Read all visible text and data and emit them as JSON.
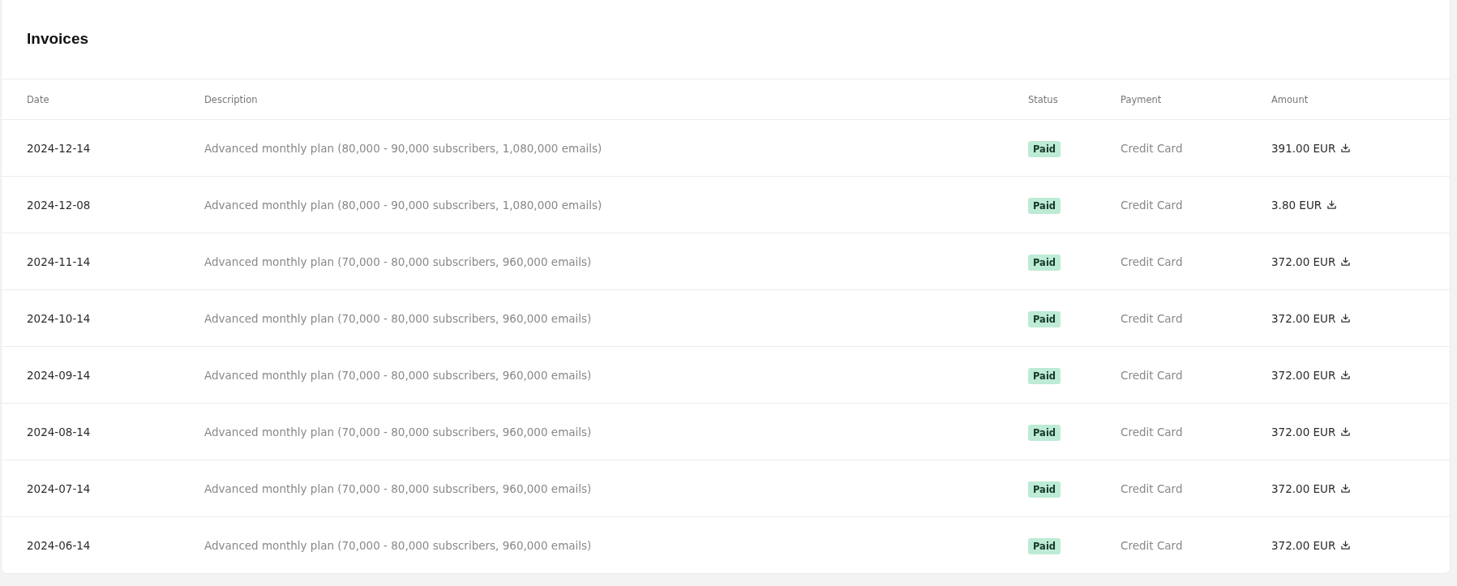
{
  "title": "Invoices",
  "columns": [
    "Date",
    "Description",
    "Status",
    "Payment",
    "Amount"
  ],
  "rows": [
    {
      "date": "2024-12-14",
      "description": "Advanced monthly plan (80,000 - 90,000 subscribers, 1,080,000 emails)",
      "status": "Paid",
      "payment": "Credit Card",
      "amount": "391.00 EUR"
    },
    {
      "date": "2024-12-08",
      "description": "Advanced monthly plan (80,000 - 90,000 subscribers, 1,080,000 emails)",
      "status": "Paid",
      "payment": "Credit Card",
      "amount": "3.80 EUR"
    },
    {
      "date": "2024-11-14",
      "description": "Advanced monthly plan (70,000 - 80,000 subscribers, 960,000 emails)",
      "status": "Paid",
      "payment": "Credit Card",
      "amount": "372.00 EUR"
    },
    {
      "date": "2024-10-14",
      "description": "Advanced monthly plan (70,000 - 80,000 subscribers, 960,000 emails)",
      "status": "Paid",
      "payment": "Credit Card",
      "amount": "372.00 EUR"
    },
    {
      "date": "2024-09-14",
      "description": "Advanced monthly plan (70,000 - 80,000 subscribers, 960,000 emails)",
      "status": "Paid",
      "payment": "Credit Card",
      "amount": "372.00 EUR"
    },
    {
      "date": "2024-08-14",
      "description": "Advanced monthly plan (70,000 - 80,000 subscribers, 960,000 emails)",
      "status": "Paid",
      "payment": "Credit Card",
      "amount": "372.00 EUR"
    },
    {
      "date": "2024-07-14",
      "description": "Advanced monthly plan (70,000 - 80,000 subscribers, 960,000 emails)",
      "status": "Paid",
      "payment": "Credit Card",
      "amount": "372.00 EUR"
    },
    {
      "date": "2024-06-14",
      "description": "Advanced monthly plan (70,000 - 80,000 subscribers, 960,000 emails)",
      "status": "Paid",
      "payment": "Credit Card",
      "amount": "372.00 EUR"
    }
  ]
}
